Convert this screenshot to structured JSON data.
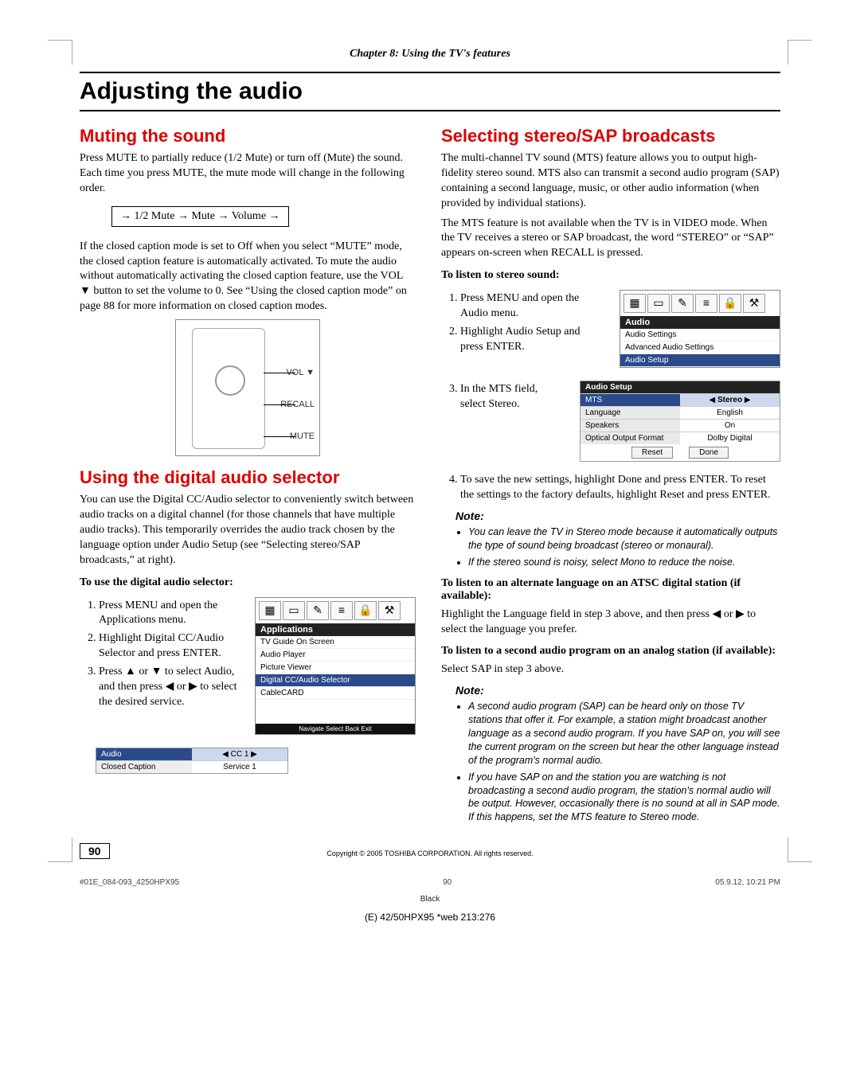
{
  "chapter_header": "Chapter 8: Using the TV's features",
  "page_title": "Adjusting the audio",
  "left": {
    "h_muting": "Muting the sound",
    "mute_p1": "Press MUTE to partially reduce (1/2 Mute) or turn off (Mute) the sound. Each time you press MUTE, the mute mode will change in the following order.",
    "mute_cycle": "→ 1/2 Mute → Mute → Volume →",
    "mute_p2": "If the closed caption mode is set to Off when you select “MUTE” mode, the closed caption feature is automatically activated. To mute the audio without automatically activating the closed caption feature, use the VOL ▼ button to set the volume to 0. See “Using the closed caption mode” on page 88 for more information on closed caption modes.",
    "remote_labels": {
      "vol": "VOL ▼",
      "recall": "RECALL",
      "mute": "MUTE"
    },
    "h_digital": "Using the digital audio selector",
    "digital_p1": "You can use the Digital CC/Audio selector to conveniently switch between audio tracks on a digital channel (for those channels that have multiple audio tracks). This temporarily overrides the audio track chosen by the language option under Audio Setup (see “Selecting stereo/SAP broadcasts,” at right).",
    "digital_bold": "To use the digital audio selector:",
    "digital_steps": [
      "Press MENU and open the Applications menu.",
      "Highlight Digital CC/Audio Selector and press ENTER.",
      "Press ▲ or ▼ to select Audio, and then press ◀ or ▶ to select the desired service."
    ],
    "apps_menu": {
      "header": "Applications",
      "items": [
        "TV Guide On Screen",
        "Audio Player",
        "Picture Viewer",
        "Digital CC/Audio Selector",
        "CableCARD"
      ],
      "hintbar": "Navigate   Select   Back   Exit"
    },
    "svc_table": {
      "rows": [
        {
          "l": "Audio",
          "v": "CC 1"
        },
        {
          "l": "Closed Caption",
          "v": "Service 1"
        }
      ]
    }
  },
  "right": {
    "h_stereo": "Selecting stereo/SAP broadcasts",
    "stereo_p1": "The multi-channel TV sound (MTS) feature allows you to output high-fidelity stereo sound. MTS also can transmit a second audio program (SAP) containing a second language, music, or other audio information (when provided by individual stations).",
    "stereo_p2": "The MTS feature is not available when the TV is in VIDEO mode. When the TV receives a stereo or SAP broadcast, the word “STEREO” or “SAP” appears on-screen when RECALL is pressed.",
    "stereo_bold1": "To listen to stereo sound:",
    "stereo_steps_a": [
      "Press MENU and open the Audio menu.",
      "Highlight Audio Setup and press ENTER."
    ],
    "audio_menu": {
      "header": "Audio",
      "items": [
        "Audio Settings",
        "Advanced Audio Settings",
        "Audio Setup"
      ]
    },
    "stereo_step3": "In the MTS field, select Stereo.",
    "audio_setup_table": {
      "header": "Audio Setup",
      "rows": [
        {
          "l": "MTS",
          "v": "Stereo",
          "hl": true
        },
        {
          "l": "Language",
          "v": "English"
        },
        {
          "l": "Speakers",
          "v": "On"
        },
        {
          "l": "Optical Output Format",
          "v": "Dolby Digital"
        }
      ],
      "reset": "Reset",
      "done": "Done"
    },
    "stereo_step4": "To save the new settings, highlight Done and press ENTER. To reset the settings to the factory defaults, highlight Reset and press ENTER.",
    "note_label": "Note:",
    "notes_a": [
      "You can leave the TV in Stereo mode because it automatically outputs the type of sound being broadcast (stereo or monaural).",
      "If the stereo sound is noisy, select Mono to reduce the noise."
    ],
    "alt_bold": "To listen to an alternate language on an ATSC digital station (if available):",
    "alt_p": "Highlight the Language field in step 3 above, and then press ◀ or ▶ to select the language you prefer.",
    "sap_bold": "To listen to a second audio program on an analog station (if available):",
    "sap_p": "Select SAP in step 3 above.",
    "notes_b": [
      "A second audio program (SAP) can be heard only on those TV stations that offer it. For example, a station might broadcast another language as a second audio program. If you have SAP on, you will see the current program on the screen but hear the other language instead of the program's normal audio.",
      "If you have SAP on and the station you are watching is not broadcasting a second audio program, the station's normal audio will be output. However, occasionally there is no sound at all in SAP mode. If this happens, set the MTS feature to Stereo mode."
    ]
  },
  "page_number": "90",
  "copyright": "Copyright © 2005 TOSHIBA CORPORATION. All rights reserved.",
  "footer_file": "#01E_084-093_4250HPX95",
  "footer_page": "90",
  "footer_date": "05.9.12, 10:21 PM",
  "footer_black": "Black",
  "footer_model": "(E) 42/50HPX95 *web 213:276"
}
